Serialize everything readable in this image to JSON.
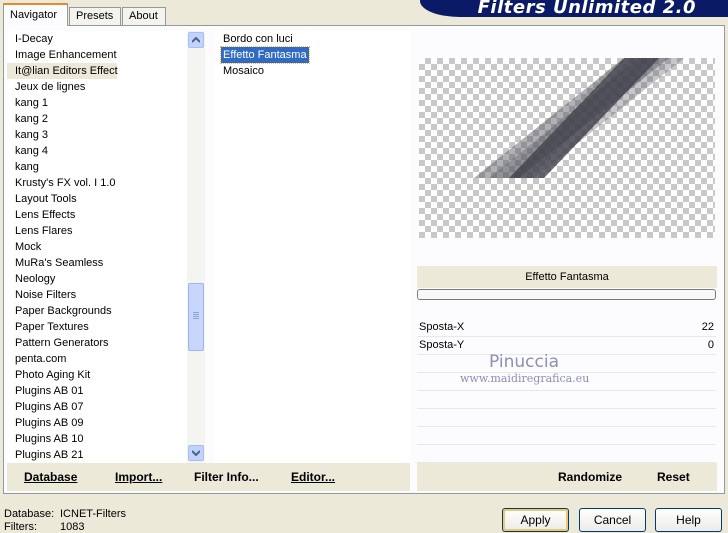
{
  "tabs": [
    "Navigator",
    "Presets",
    "About"
  ],
  "app_title": "Filters Unlimited 2.0",
  "categories": [
    "I-Decay",
    "Image Enhancement",
    "It@lian Editors Effect",
    "Jeux de lignes",
    "kang 1",
    "kang 2",
    "kang 3",
    "kang 4",
    "kang",
    "Krusty's FX vol. I 1.0",
    "Layout Tools",
    "Lens Effects",
    "Lens Flares",
    "Mock",
    "MuRa's Seamless",
    "Neology",
    "Noise Filters",
    "Paper Backgrounds",
    "Paper Textures",
    "Pattern Generators",
    "penta.com",
    "Photo Aging Kit",
    "Plugins AB 01",
    "Plugins AB 07",
    "Plugins AB 09",
    "Plugins AB 10",
    "Plugins AB 21"
  ],
  "selected_category": "It@lian Editors Effect",
  "filters": [
    "Bordo con luci",
    "Effetto Fantasma",
    "Mosaico"
  ],
  "selected_filter": "Effetto Fantasma",
  "preview": {
    "filter_name": "Effetto Fantasma"
  },
  "params": [
    {
      "label": "Sposta-X",
      "value": "22"
    },
    {
      "label": "Sposta-Y",
      "value": "0"
    }
  ],
  "watermark": {
    "name": "Pinuccia",
    "url": "www.maidiregrafica.eu"
  },
  "left_buttons": {
    "database": "Database",
    "import": "Import...",
    "filter_info": "Filter Info...",
    "editor": "Editor..."
  },
  "right_buttons": {
    "randomize": "Randomize",
    "reset": "Reset"
  },
  "status": {
    "database_label": "Database:",
    "database_value": "ICNET-Filters",
    "filters_label": "Filters:",
    "filters_value": "1083"
  },
  "dialog": {
    "apply": "Apply",
    "cancel": "Cancel",
    "help": "Help"
  },
  "colors": {
    "selection": "#316ac5",
    "title_banner": "#0a1a66",
    "tab_highlight": "#e68b2c"
  }
}
